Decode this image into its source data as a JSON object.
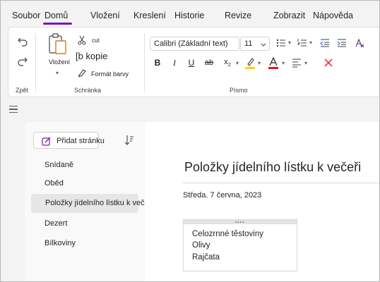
{
  "menu": {
    "tabs": [
      {
        "label": "Soubor"
      },
      {
        "label": "Domů",
        "active": true
      },
      {
        "label": "Vložení"
      },
      {
        "label": "Kreslení"
      },
      {
        "label": "Historie"
      },
      {
        "label": "Revize"
      },
      {
        "label": "Zobrazit"
      },
      {
        "label": "Nápověda"
      }
    ],
    "accent_color": "#7719aa"
  },
  "ribbon": {
    "groups": {
      "undo": {
        "label": "Zpět",
        "icons": [
          "undo-icon",
          "redo-icon"
        ]
      },
      "clipboard": {
        "label": "Schránka",
        "paste_label": "Vložení",
        "cut_label": "cut",
        "copy_label": "[b kopie",
        "format_painter_label": "Formát barvy"
      },
      "font": {
        "label": "Písmo",
        "font_name": "Calibri (Základní text)",
        "font_size": "11",
        "font_color": "#e81123",
        "highlight_color": "#ffd400"
      }
    }
  },
  "pages": {
    "add_page_label": "Přidat stránku",
    "items": [
      {
        "label": "Snídaně"
      },
      {
        "label": "Oběd"
      },
      {
        "label": "Položky jídelního lístku k večeři",
        "selected": true
      },
      {
        "label": "Dezert"
      },
      {
        "label": "Bílkoviny"
      }
    ]
  },
  "page": {
    "title": "Položky jídelního lístku k večeři",
    "date": "Středa. 7 června, 2023",
    "note_lines": [
      "Celozrnné těstoviny",
      "Olivy",
      "Rajčata"
    ]
  }
}
